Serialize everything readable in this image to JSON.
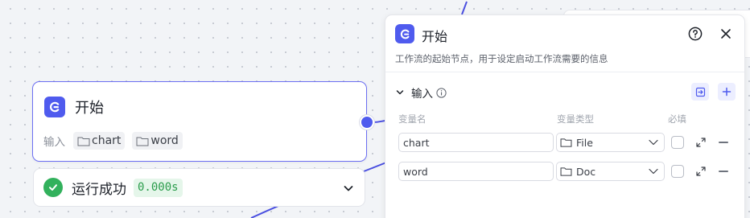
{
  "node": {
    "title": "开始",
    "io_label": "输入",
    "inputs": [
      "chart",
      "word"
    ]
  },
  "status": {
    "text": "运行成功",
    "time": "0.000s"
  },
  "panel": {
    "title": "开始",
    "description": "工作流的起始节点，用于设定启动工作流需要的信息",
    "section_title": "输入",
    "columns": {
      "name": "变量名",
      "type": "变量类型",
      "required": "必填"
    },
    "rows": [
      {
        "name": "chart",
        "type": "File",
        "required": false
      },
      {
        "name": "word",
        "type": "Doc",
        "required": false
      }
    ]
  },
  "colors": {
    "accent": "#4f5bee",
    "success": "#32b15c",
    "edge": "#4a4fe0"
  },
  "icons": {
    "node": "start-logo-icon",
    "status": "check-circle-icon",
    "help": "help-circle-icon",
    "close": "close-icon",
    "collapse": "chevron-down-icon",
    "info": "info-icon",
    "import": "import-icon",
    "add": "plus-icon",
    "folder": "folder-icon",
    "expand": "expand-icon",
    "remove": "minus-icon"
  }
}
